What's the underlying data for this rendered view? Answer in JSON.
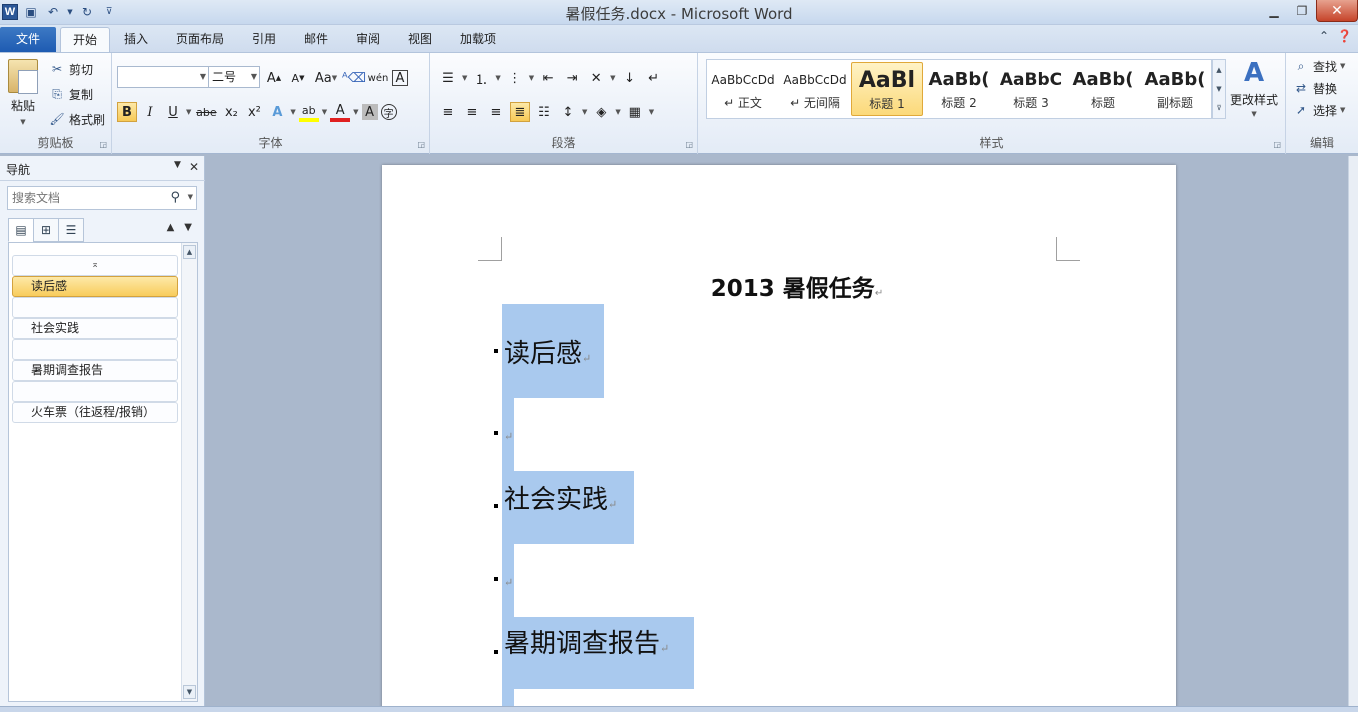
{
  "window": {
    "title": "暑假任务.docx - Microsoft Word",
    "logo_letter": "W"
  },
  "tabs": [
    {
      "label": "文件"
    },
    {
      "label": "开始"
    },
    {
      "label": "插入"
    },
    {
      "label": "页面布局"
    },
    {
      "label": "引用"
    },
    {
      "label": "邮件"
    },
    {
      "label": "审阅"
    },
    {
      "label": "视图"
    },
    {
      "label": "加载项"
    }
  ],
  "ribbon": {
    "clipboard": {
      "label": "剪贴板",
      "paste": "粘贴",
      "cut": "剪切",
      "copy": "复制",
      "format_painter": "格式刷"
    },
    "font": {
      "label": "字体",
      "font_name": "",
      "font_size": "二号"
    },
    "paragraph": {
      "label": "段落"
    },
    "styles": {
      "label": "样式",
      "change_styles": "更改样式",
      "items": [
        {
          "sample": "AaBbCcDd",
          "name": "↵ 正文"
        },
        {
          "sample": "AaBbCcDd",
          "name": "↵ 无间隔"
        },
        {
          "sample": "AaBl",
          "name": "标题 1"
        },
        {
          "sample": "AaBb(",
          "name": "标题 2"
        },
        {
          "sample": "AaBbC",
          "name": "标题 3"
        },
        {
          "sample": "AaBb(",
          "name": "标题"
        },
        {
          "sample": "AaBb(",
          "name": "副标题"
        }
      ]
    },
    "editing": {
      "label": "编辑",
      "find": "查找",
      "replace": "替换",
      "select": "选择"
    }
  },
  "nav": {
    "title": "导航",
    "search_placeholder": "搜索文档",
    "headings": [
      {
        "label": "读后感"
      },
      {
        "label": ""
      },
      {
        "label": "社会实践"
      },
      {
        "label": ""
      },
      {
        "label": "暑期调查报告"
      },
      {
        "label": ""
      },
      {
        "label": "火车票（往返程/报销）"
      }
    ]
  },
  "document": {
    "title": "2013 暑假任务",
    "lines": [
      {
        "text": "读后感"
      },
      {
        "text": ""
      },
      {
        "text": "社会实践"
      },
      {
        "text": ""
      },
      {
        "text": "暑期调查报告"
      }
    ]
  },
  "colors": {
    "selection": "#a9c9ee",
    "file_tab": "#2b63b8",
    "active_highlight": "#f8cc5c"
  }
}
